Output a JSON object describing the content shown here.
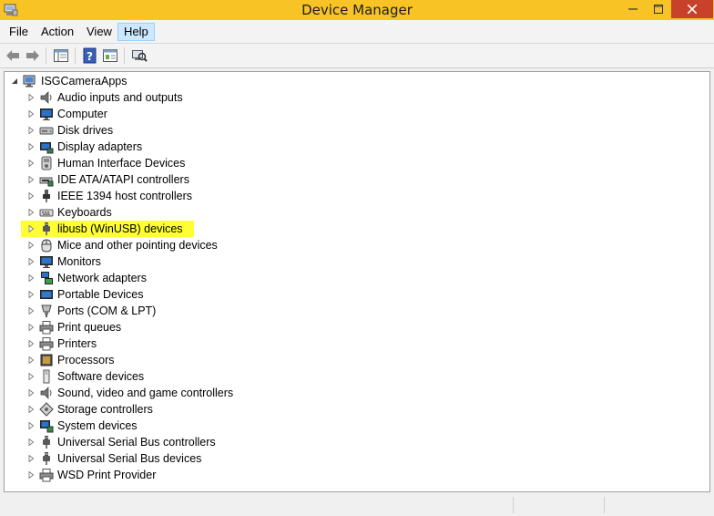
{
  "window": {
    "title": "Device Manager",
    "accent_color": "#f7c325",
    "close_color": "#c7412b"
  },
  "menu": {
    "items": [
      {
        "label": "File"
      },
      {
        "label": "Action"
      },
      {
        "label": "View"
      },
      {
        "label": "Help",
        "active": true
      }
    ]
  },
  "toolbar": {
    "icons": [
      "back-arrow-icon",
      "forward-arrow-icon",
      "show-hide-console-tree-icon",
      "help-icon",
      "properties-icon",
      "scan-hardware-icon"
    ]
  },
  "tree": {
    "root": {
      "label": "ISGCameraApps",
      "icon": "computer-icon",
      "expanded": true
    },
    "items": [
      {
        "label": "Audio inputs and outputs",
        "icon": "speaker-icon"
      },
      {
        "label": "Computer",
        "icon": "monitor-icon"
      },
      {
        "label": "Disk drives",
        "icon": "disk-drive-icon"
      },
      {
        "label": "Display adapters",
        "icon": "display-adapter-icon"
      },
      {
        "label": "Human Interface Devices",
        "icon": "hid-icon"
      },
      {
        "label": "IDE ATA/ATAPI controllers",
        "icon": "ide-controller-icon"
      },
      {
        "label": "IEEE 1394 host controllers",
        "icon": "ieee1394-icon"
      },
      {
        "label": "Keyboards",
        "icon": "keyboard-icon"
      },
      {
        "label": "libusb (WinUSB) devices",
        "icon": "usb-plug-icon",
        "highlighted": true
      },
      {
        "label": "Mice and other pointing devices",
        "icon": "mouse-icon"
      },
      {
        "label": "Monitors",
        "icon": "monitor-icon"
      },
      {
        "label": "Network adapters",
        "icon": "network-adapter-icon"
      },
      {
        "label": "Portable Devices",
        "icon": "portable-device-icon"
      },
      {
        "label": "Ports (COM & LPT)",
        "icon": "port-icon"
      },
      {
        "label": "Print queues",
        "icon": "printer-icon"
      },
      {
        "label": "Printers",
        "icon": "printer-icon"
      },
      {
        "label": "Processors",
        "icon": "processor-icon"
      },
      {
        "label": "Software devices",
        "icon": "software-device-icon"
      },
      {
        "label": "Sound, video and game controllers",
        "icon": "speaker-icon"
      },
      {
        "label": "Storage controllers",
        "icon": "storage-controller-icon"
      },
      {
        "label": "System devices",
        "icon": "system-device-icon"
      },
      {
        "label": "Universal Serial Bus controllers",
        "icon": "usb-plug-icon"
      },
      {
        "label": "Universal Serial Bus devices",
        "icon": "usb-plug-icon"
      },
      {
        "label": "WSD Print Provider",
        "icon": "printer-icon"
      }
    ],
    "highlight_color": "#ffff33"
  }
}
